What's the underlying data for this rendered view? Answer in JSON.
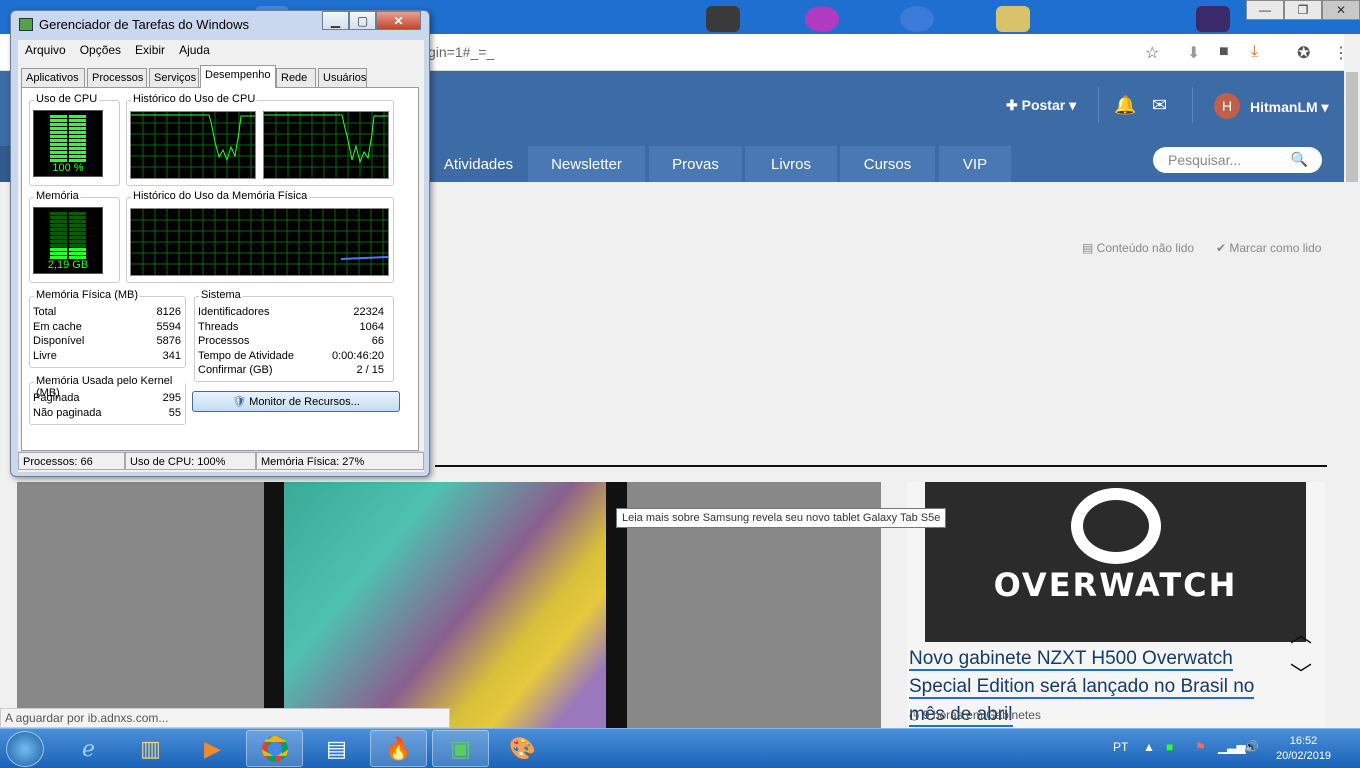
{
  "browser": {
    "url_fragment": "gin=1#_=_",
    "window_controls": {
      "minimize": "—",
      "maximize": "❐",
      "close": "✕"
    }
  },
  "site": {
    "post_label": "Postar",
    "username": "HitmanLM",
    "avatar_initial": "H",
    "nav_tabs": [
      "Atividades",
      "Newsletter",
      "Provas",
      "Livros",
      "Cursos",
      "VIP"
    ],
    "search_placeholder": "Pesquisar...",
    "unread_label": "Conteúdo não lido",
    "mark_read_label": "Marcar como lido",
    "tooltip": "Leia mais sobre Samsung revela seu novo tablet Galaxy Tab S5e",
    "article": {
      "image_brand": "OVERWATCH",
      "title": "Novo gabinete NZXT H500 Overwatch Special Edition será lançado no Brasil no mês de abril",
      "meta": "9 horas em Gabinetes"
    },
    "loading_status": "A aguardar por ib.adnxs.com..."
  },
  "task_manager": {
    "title": "Gerenciador de Tarefas do Windows",
    "menu": [
      "Arquivo",
      "Opções",
      "Exibir",
      "Ajuda"
    ],
    "tabs": [
      "Aplicativos",
      "Processos",
      "Serviços",
      "Desempenho",
      "Rede",
      "Usuários"
    ],
    "active_tab": "Desempenho",
    "cpu_usage_label": "Uso de CPU",
    "cpu_usage_value": "100 %",
    "cpu_usage_fraction": 1.0,
    "cpu_history_label": "Histórico do Uso de CPU",
    "memory_label": "Memória",
    "memory_value": "2,19 GB",
    "memory_fraction": 0.27,
    "memory_history_label": "Histórico do Uso da Memória Física",
    "physical_memory": {
      "label": "Memória Física (MB)",
      "rows": [
        {
          "name": "Total",
          "value": "8126"
        },
        {
          "name": "Em cache",
          "value": "5594"
        },
        {
          "name": "Disponível",
          "value": "5876"
        },
        {
          "name": "Livre",
          "value": "341"
        }
      ]
    },
    "kernel_memory": {
      "label": "Memória Usada pelo Kernel (MB)",
      "rows": [
        {
          "name": "Paginada",
          "value": "295"
        },
        {
          "name": "Não paginada",
          "value": "55"
        }
      ]
    },
    "system": {
      "label": "Sistema",
      "rows": [
        {
          "name": "Identificadores",
          "value": "22324"
        },
        {
          "name": "Threads",
          "value": "1064"
        },
        {
          "name": "Processos",
          "value": "66"
        },
        {
          "name": "Tempo de Atividade",
          "value": "0:00:46:20"
        },
        {
          "name": "Confirmar (GB)",
          "value": "2 / 15"
        }
      ]
    },
    "resource_monitor_button": "Monitor de Recursos...",
    "status": {
      "processes": "Processos: 66",
      "cpu": "Uso de CPU: 100%",
      "memory": "Memória Física: 27%"
    }
  },
  "taskbar": {
    "language": "PT",
    "time": "16:52",
    "date": "20/02/2019"
  },
  "colors": {
    "site_header": "#3d6ba5",
    "taskbar": "#1a63b8",
    "meter_green": "#2cff2c"
  }
}
